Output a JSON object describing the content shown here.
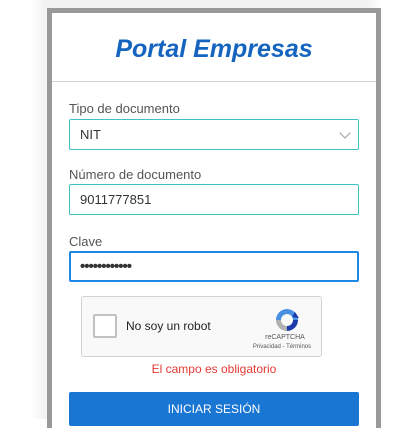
{
  "header": {
    "title": "Portal Empresas"
  },
  "form": {
    "doc_type": {
      "label": "Tipo de documento",
      "value": "NIT"
    },
    "doc_number": {
      "label": "Número de documento",
      "value": "9011777851"
    },
    "password": {
      "label": "Clave",
      "value": "••••••••••••"
    },
    "captcha": {
      "checkbox_label": "No soy un robot",
      "brand": "reCAPTCHA",
      "links": "Privacidad - Términos",
      "checked": false
    },
    "error_text": "El campo es obligatorio",
    "submit_label": "INICIAR SESIÓN"
  },
  "colors": {
    "title": "#1565c0",
    "field_border": "#3cc2c2",
    "focus_border": "#1e88e5",
    "error": "#e53935",
    "button": "#1976d2"
  }
}
